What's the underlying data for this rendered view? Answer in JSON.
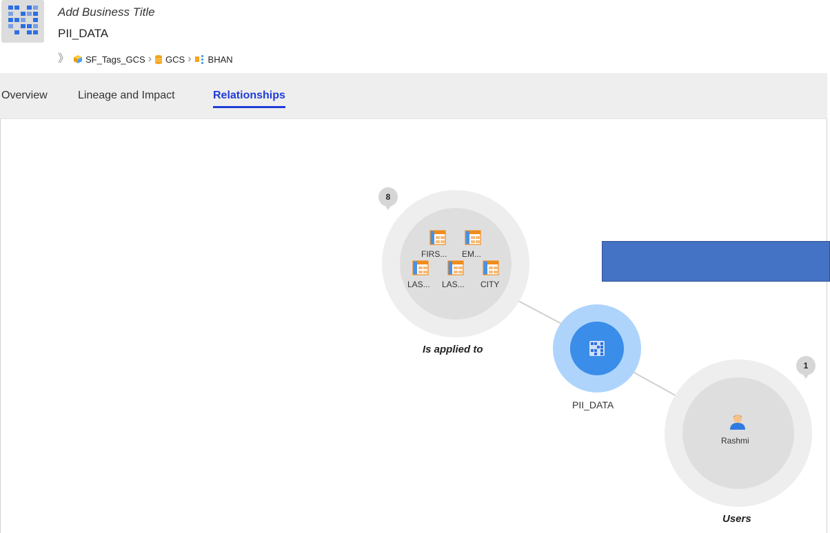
{
  "header": {
    "business_title": "Add Business Title",
    "asset_name": "PII_DATA",
    "breadcrumb": [
      {
        "label": "SF_Tags_GCS",
        "icon": "cube-icon"
      },
      {
        "label": "GCS",
        "icon": "database-icon"
      },
      {
        "label": "BHAN",
        "icon": "schema-icon"
      }
    ]
  },
  "tabs": [
    {
      "label": "Overview",
      "active": false
    },
    {
      "label": "Lineage and Impact",
      "active": false
    },
    {
      "label": "Relationships",
      "active": true
    }
  ],
  "graph": {
    "center": {
      "label": "PII_DATA"
    },
    "applied_group": {
      "label": "Is applied to",
      "count": "8",
      "members": [
        "FIRS...",
        "EM...",
        "LAS...",
        "LAS...",
        "CITY"
      ]
    },
    "users_group": {
      "label": "Users",
      "count": "1",
      "members": [
        "Rashmi"
      ]
    }
  },
  "colors": {
    "accent": "#1e3cd8",
    "center_node": "#3a8de8",
    "center_halo": "#aed4fb",
    "overlay_rect": "#4472c4"
  }
}
